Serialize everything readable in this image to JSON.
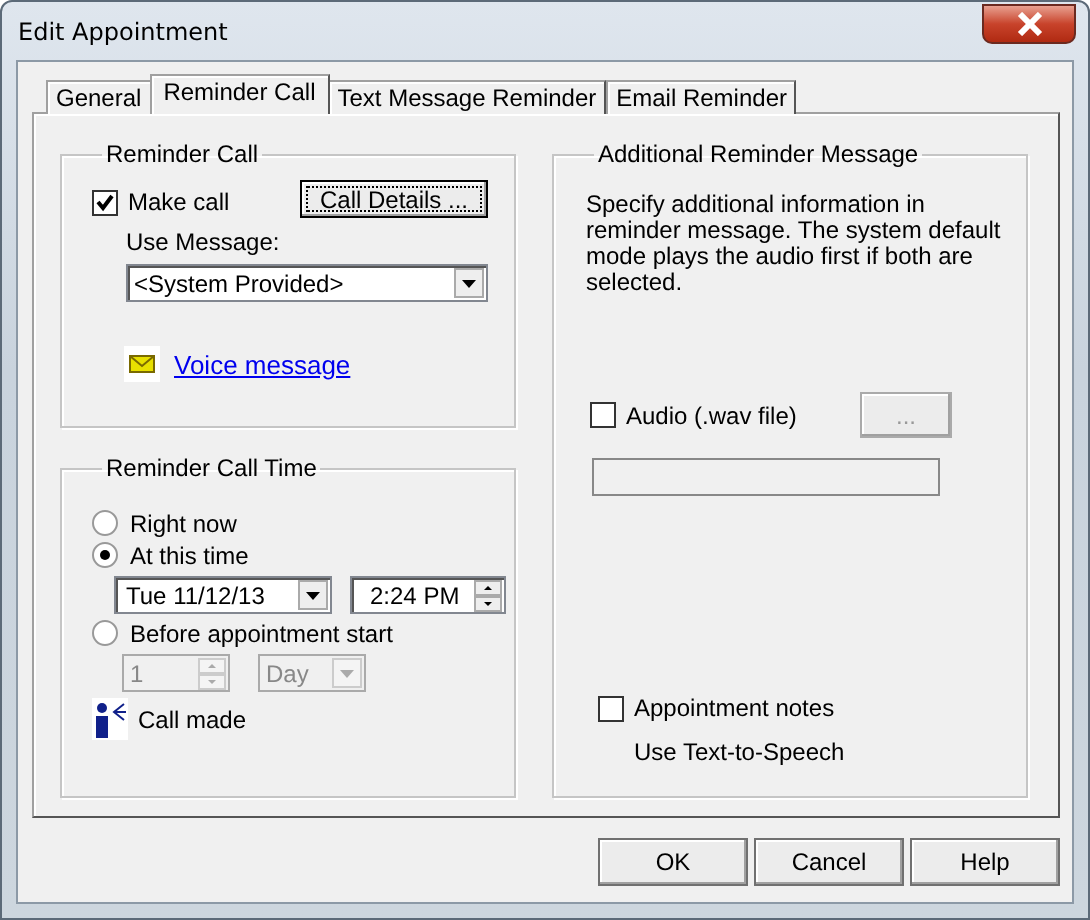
{
  "window": {
    "title": "Edit Appointment"
  },
  "tabs": [
    {
      "label": "General",
      "selected": false
    },
    {
      "label": "Reminder Call",
      "selected": true
    },
    {
      "label": "Text Message Reminder",
      "selected": false
    },
    {
      "label": "Email Reminder",
      "selected": false
    }
  ],
  "reminder_call": {
    "title": "Reminder Call",
    "make_call": {
      "label": "Make call",
      "checked": true
    },
    "call_details_button": "Call Details ...",
    "use_message_label": "Use Message:",
    "message": "<System Provided>",
    "voice_message_link": "Voice message"
  },
  "reminder_call_time": {
    "title": "Reminder Call Time",
    "options": [
      {
        "label": "Right now",
        "selected": false
      },
      {
        "label": "At this time",
        "selected": true,
        "date": "Tue  11/12/13",
        "time": "2:24 PM"
      },
      {
        "label": "Before appointment start",
        "selected": false,
        "count": "1",
        "unit": "Day"
      }
    ],
    "status": "Call made"
  },
  "additional_message": {
    "title": "Additional Reminder Message",
    "description": "Specify additional information in reminder message. The system default mode plays the audio first if both are selected.",
    "audio": {
      "label": "Audio (.wav file)",
      "checked": false
    },
    "browse_button": "...",
    "appointment_notes": {
      "label": "Appointment notes",
      "checked": false
    },
    "tts_note": "Use Text-to-Speech"
  },
  "buttons": [
    "OK",
    "Cancel",
    "Help"
  ]
}
